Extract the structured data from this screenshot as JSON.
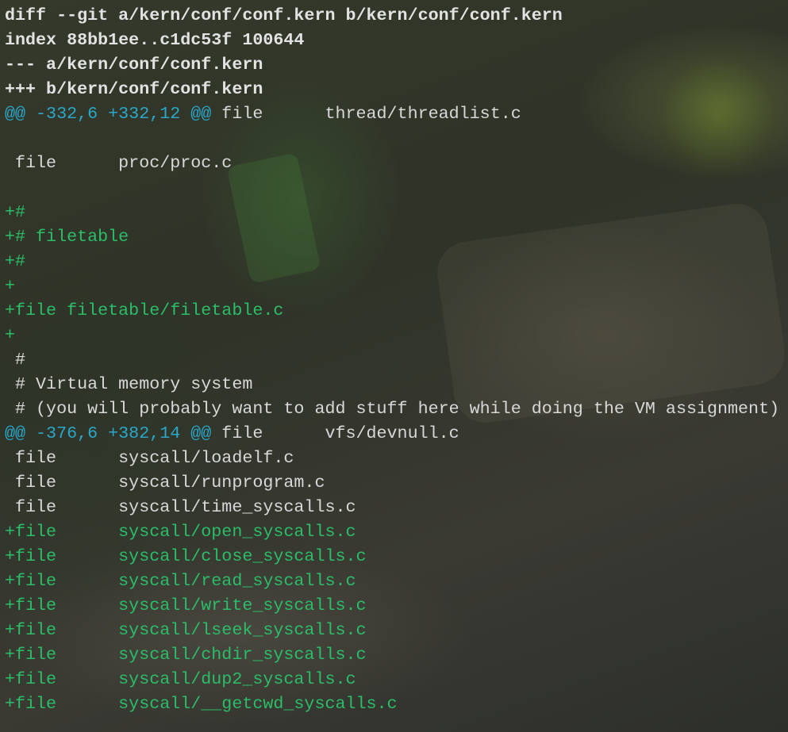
{
  "diff": {
    "lines": [
      {
        "type": "header",
        "text": "diff --git a/kern/conf/conf.kern b/kern/conf/conf.kern"
      },
      {
        "type": "header",
        "text": "index 88bb1ee..c1dc53f 100644"
      },
      {
        "type": "header",
        "text": "--- a/kern/conf/conf.kern"
      },
      {
        "type": "header",
        "text": "+++ b/kern/conf/conf.kern"
      },
      {
        "type": "hunk",
        "marker": "@@ -332,6 +332,12 @@",
        "text": " file      thread/threadlist.c"
      },
      {
        "type": "context",
        "text": ""
      },
      {
        "type": "context",
        "text": " file      proc/proc.c"
      },
      {
        "type": "context",
        "text": ""
      },
      {
        "type": "added",
        "text": "+#"
      },
      {
        "type": "added",
        "text": "+# filetable"
      },
      {
        "type": "added",
        "text": "+#"
      },
      {
        "type": "added",
        "text": "+"
      },
      {
        "type": "added",
        "text": "+file filetable/filetable.c"
      },
      {
        "type": "added",
        "text": "+"
      },
      {
        "type": "context",
        "text": " #"
      },
      {
        "type": "context",
        "text": " # Virtual memory system"
      },
      {
        "type": "context",
        "text": " # (you will probably want to add stuff here while doing the VM assignment)"
      },
      {
        "type": "hunk",
        "marker": "@@ -376,6 +382,14 @@",
        "text": " file      vfs/devnull.c"
      },
      {
        "type": "context",
        "text": " file      syscall/loadelf.c"
      },
      {
        "type": "context",
        "text": " file      syscall/runprogram.c"
      },
      {
        "type": "context",
        "text": " file      syscall/time_syscalls.c"
      },
      {
        "type": "added",
        "text": "+file      syscall/open_syscalls.c"
      },
      {
        "type": "added",
        "text": "+file      syscall/close_syscalls.c"
      },
      {
        "type": "added",
        "text": "+file      syscall/read_syscalls.c"
      },
      {
        "type": "added",
        "text": "+file      syscall/write_syscalls.c"
      },
      {
        "type": "added",
        "text": "+file      syscall/lseek_syscalls.c"
      },
      {
        "type": "added",
        "text": "+file      syscall/chdir_syscalls.c"
      },
      {
        "type": "added",
        "text": "+file      syscall/dup2_syscalls.c"
      },
      {
        "type": "added",
        "text": "+file      syscall/__getcwd_syscalls.c"
      }
    ]
  },
  "colors": {
    "header": "#e2e2e2",
    "hunk_marker": "#2aa7c9",
    "context": "#d8d8d8",
    "added": "#2bbd68"
  }
}
